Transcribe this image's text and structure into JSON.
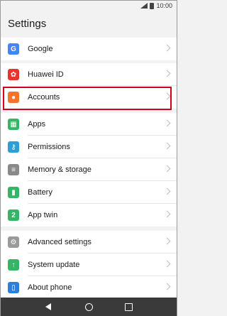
{
  "status_bar": {
    "time": "10:00"
  },
  "page_title": "Settings",
  "groups": [
    {
      "items": [
        {
          "label": "Google",
          "icon": "google-icon",
          "color": "#4285f4",
          "glyph": "G"
        }
      ]
    },
    {
      "items": [
        {
          "label": "Huawei ID",
          "icon": "huawei-icon",
          "color": "#e8342b",
          "glyph": "✿"
        },
        {
          "label": "Accounts",
          "icon": "accounts-icon",
          "color": "#f5732a",
          "glyph": "●"
        }
      ]
    },
    {
      "items": [
        {
          "label": "Apps",
          "icon": "apps-icon",
          "color": "#35b566",
          "glyph": "▦"
        },
        {
          "label": "Permissions",
          "icon": "key-icon",
          "color": "#2a9fd8",
          "glyph": "⚷"
        },
        {
          "label": "Memory & storage",
          "icon": "storage-icon",
          "color": "#8a8a8a",
          "glyph": "≡"
        },
        {
          "label": "Battery",
          "icon": "battery-icon",
          "color": "#35b566",
          "glyph": "▮"
        },
        {
          "label": "App twin",
          "icon": "app-twin-icon",
          "color": "#35b566",
          "glyph": "2"
        }
      ]
    },
    {
      "items": [
        {
          "label": "Advanced settings",
          "icon": "gear-icon",
          "color": "#9a9a9a",
          "glyph": "⚙"
        },
        {
          "label": "System update",
          "icon": "system-update-icon",
          "color": "#35b566",
          "glyph": "↑"
        },
        {
          "label": "About phone",
          "icon": "phone-icon",
          "color": "#2a7fd8",
          "glyph": "▯"
        }
      ]
    }
  ],
  "highlight_color": "#d0021b"
}
